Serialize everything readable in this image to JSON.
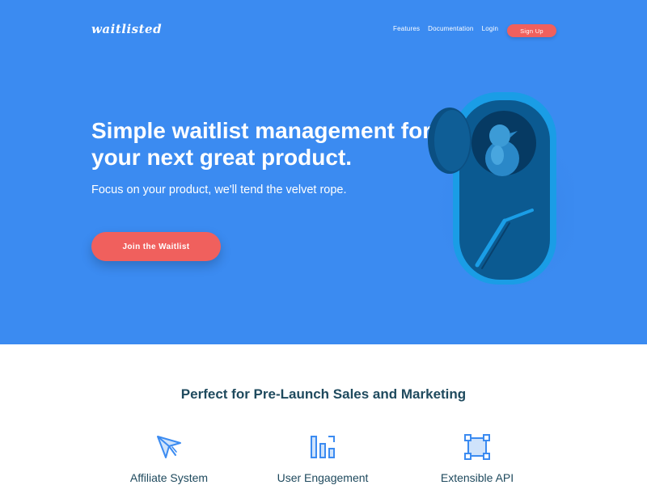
{
  "header": {
    "logo": "waitlisted",
    "nav": [
      "Features",
      "Documentation",
      "Login"
    ],
    "signup_label": "Sign Up"
  },
  "hero": {
    "headline": "Simple waitlist management for your next great product.",
    "subline": "Focus on your product, we'll tend the velvet rope.",
    "cta_label": "Join the Waitlist"
  },
  "features": {
    "title": "Perfect for Pre-Launch Sales and Marketing",
    "items": [
      {
        "label": "Affiliate System",
        "icon": "paper-plane-icon"
      },
      {
        "label": "User Engagement",
        "icon": "bar-chart-icon"
      },
      {
        "label": "Extensible API",
        "icon": "bounding-box-icon"
      }
    ]
  },
  "colors": {
    "hero_bg": "#3b8bf1",
    "accent": "#f0605d",
    "heading": "#1f4a5e"
  }
}
